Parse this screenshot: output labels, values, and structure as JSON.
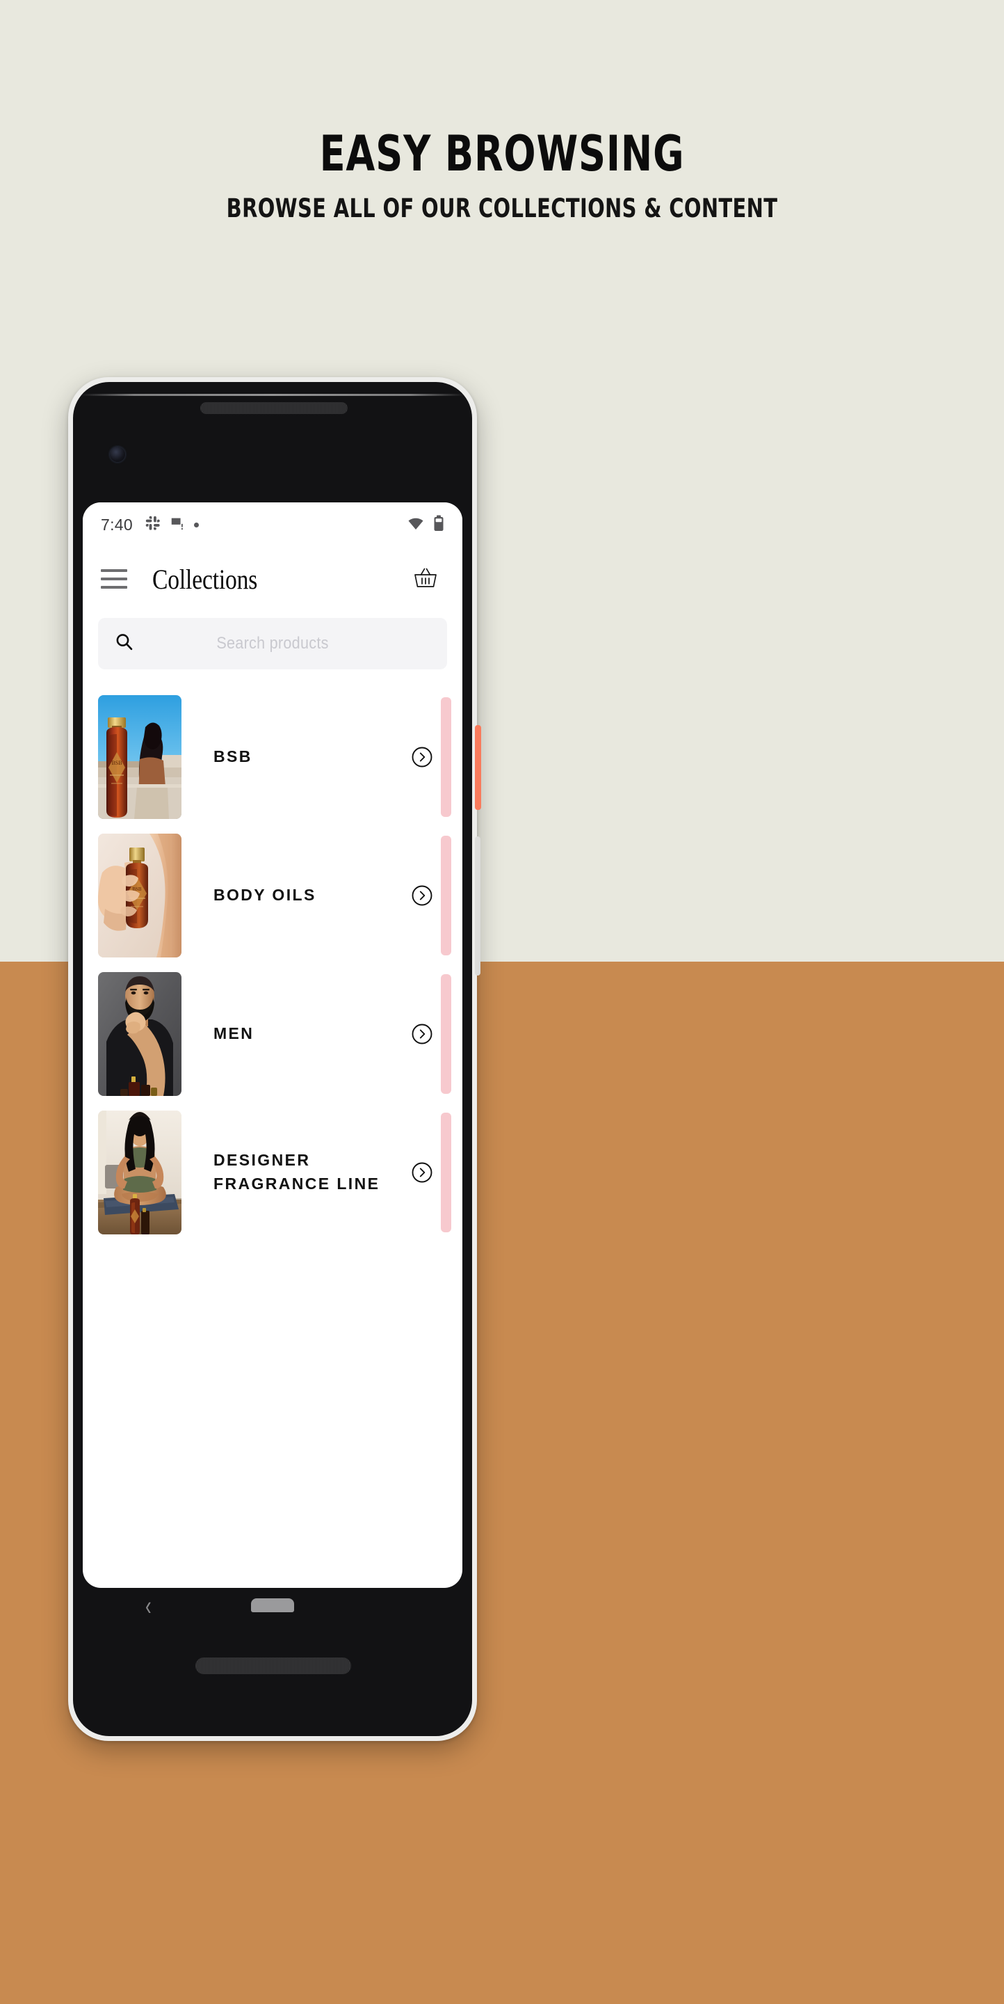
{
  "theme": {
    "bg_top": "#E8E8DE",
    "bg_bottom": "#C88A50",
    "accent_pink": "#F7C9CE",
    "power_button": "#F97B5C",
    "text_dark": "#121212",
    "search_bg": "#F4F4F6",
    "placeholder_color": "#C9C9CF"
  },
  "promo": {
    "headline": "EASY BROWSING",
    "subheadline": "BROWSE ALL OF OUR COLLECTIONS & CONTENT"
  },
  "status_bar": {
    "time": "7:40",
    "left_icons": [
      "slack-icon",
      "image-alert-icon",
      "dot-icon"
    ],
    "right_icons": [
      "wifi-icon",
      "battery-icon"
    ]
  },
  "app_bar": {
    "menu_icon": "hamburger-icon",
    "title": "Collections",
    "cart_icon": "shopping-basket-icon"
  },
  "search": {
    "icon": "search-icon",
    "placeholder": "Search products",
    "value": ""
  },
  "collections": [
    {
      "label": "BSB",
      "thumb": "amber-bottle-rooftop-woman",
      "chevron": "chevron-right-circle-icon",
      "indicator_color": "#F7C9CE"
    },
    {
      "label": "BODY OILS",
      "thumb": "hand-holding-amber-bottle",
      "chevron": "chevron-right-circle-icon",
      "indicator_color": "#F7C9CE"
    },
    {
      "label": "MEN",
      "thumb": "bearded-man-black-tee",
      "chevron": "chevron-right-circle-icon",
      "indicator_color": "#F7C9CE"
    },
    {
      "label": "DESIGNER\nFRAGRANCE LINE",
      "thumb": "woman-meditating-yoga-mat",
      "chevron": "chevron-right-circle-icon",
      "indicator_color": "#F7C9CE"
    }
  ],
  "nav_bar": {
    "back_icon": "back-chevron-icon",
    "home_icon": "home-pill-icon"
  }
}
